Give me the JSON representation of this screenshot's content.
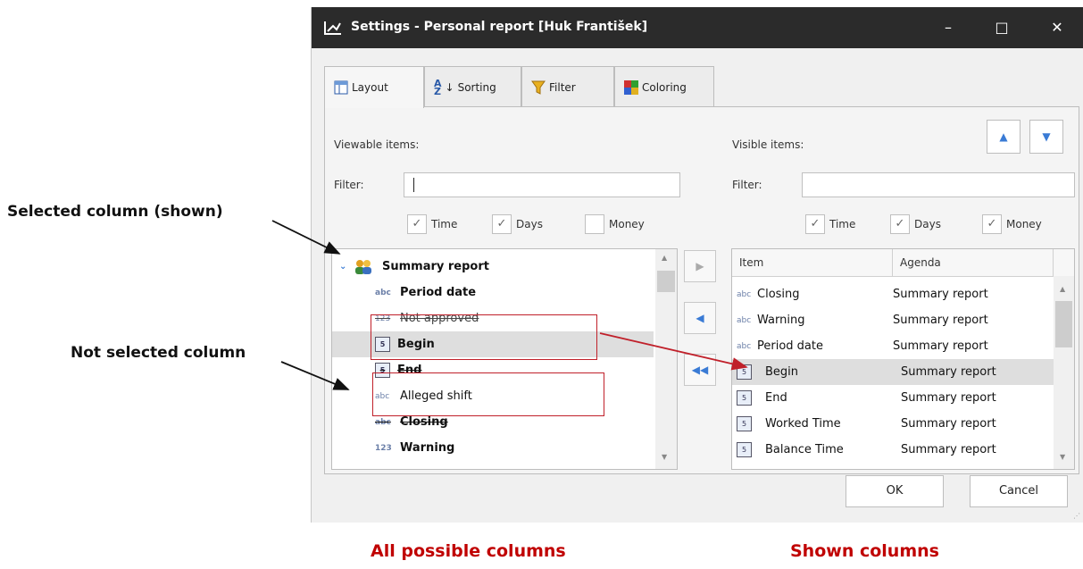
{
  "annotations": {
    "selected": "Selected column (shown)",
    "not_selected": "Not selected column"
  },
  "captions": {
    "left": "All possible columns",
    "right": "Shown columns"
  },
  "window": {
    "title": "Settings - Personal report [Huk František]",
    "min_icon": "–",
    "max_icon": "□",
    "close_icon": "✕"
  },
  "tabs": [
    {
      "label": "Layout",
      "icon": "layout-icon"
    },
    {
      "label": "Sorting",
      "icon": "sort-az-icon"
    },
    {
      "label": "Filter",
      "icon": "filter-icon"
    },
    {
      "label": "Coloring",
      "icon": "coloring-icon"
    }
  ],
  "left": {
    "header": "Viewable items:",
    "filter_label": "Filter:",
    "filter_value": "",
    "checks": [
      {
        "label": "Time",
        "checked": true
      },
      {
        "label": "Days",
        "checked": true
      },
      {
        "label": "Money",
        "checked": false
      }
    ],
    "tree_root": "Summary report",
    "items": [
      {
        "icon": "abc",
        "label": "Period date",
        "bold": true,
        "strike": false
      },
      {
        "icon": "123",
        "label": "Not approved",
        "bold": false,
        "strike": true
      },
      {
        "icon": "time",
        "label": "Begin",
        "bold": true,
        "strike": false
      },
      {
        "icon": "time",
        "label": "End",
        "bold": true,
        "strike": false
      },
      {
        "icon": "abc",
        "label": "Alleged shift",
        "bold": false,
        "strike": false
      },
      {
        "icon": "abc",
        "label": "Closing",
        "bold": true,
        "strike": true
      },
      {
        "icon": "123",
        "label": "Warning",
        "bold": true,
        "strike": false
      }
    ]
  },
  "right": {
    "header": "Visible items:",
    "filter_label": "Filter:",
    "filter_value": "",
    "checks": [
      {
        "label": "Time",
        "checked": true
      },
      {
        "label": "Days",
        "checked": true
      },
      {
        "label": "Money",
        "checked": true
      }
    ],
    "columns": [
      "Item",
      "Agenda"
    ],
    "rows": [
      {
        "icon": "abc",
        "item": "Closing",
        "agenda": "Summary report"
      },
      {
        "icon": "abc",
        "item": "Warning",
        "agenda": "Summary report"
      },
      {
        "icon": "abc",
        "item": "Period date",
        "agenda": "Summary report"
      },
      {
        "icon": "time",
        "item": "Begin",
        "agenda": "Summary report"
      },
      {
        "icon": "time",
        "item": "End",
        "agenda": "Summary report"
      },
      {
        "icon": "time",
        "item": "Worked Time",
        "agenda": "Summary report"
      },
      {
        "icon": "time",
        "item": "Balance Time",
        "agenda": "Summary report"
      }
    ]
  },
  "buttons": {
    "ok": "OK",
    "cancel": "Cancel"
  },
  "colors": {
    "annotation_red": "#c00000",
    "titlebar": "#2b2b2b",
    "accent_blue": "#3a7bd5"
  }
}
